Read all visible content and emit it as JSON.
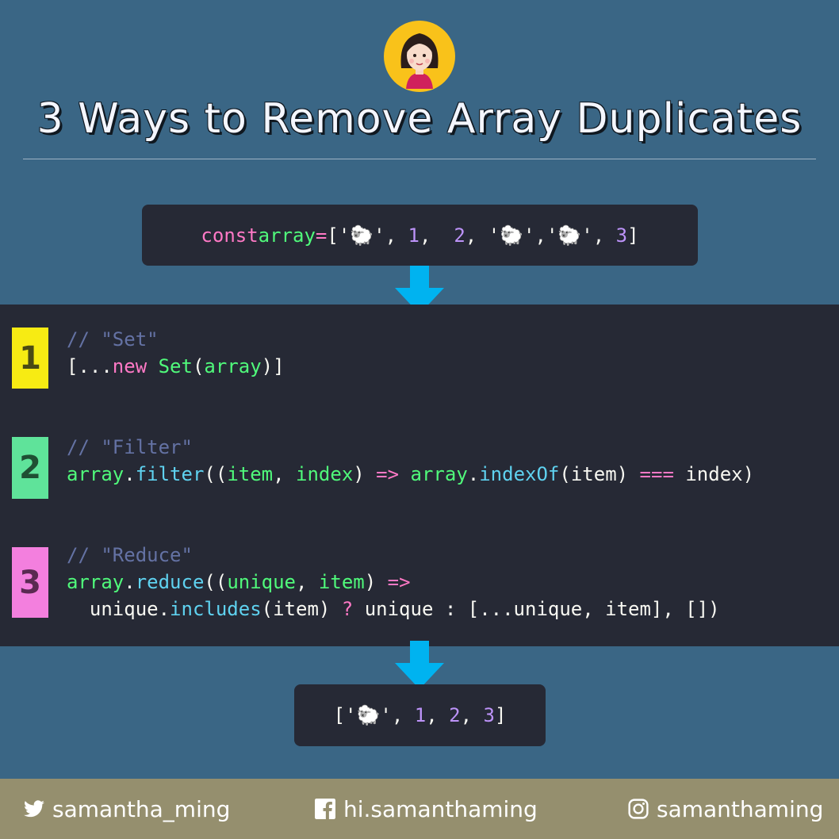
{
  "title": "3 Ways to Remove Array Duplicates",
  "input_code": {
    "kw": "const",
    "var": "array",
    "eq": "=",
    "open": "['",
    "sheep": "🐑",
    "q_comma": "', ",
    "n1": "1",
    "c1": ",  ",
    "n2": "2",
    "c2": ", '",
    "sheep2": "🐑",
    "mid": "','",
    "sheep3": "🐑",
    "q_comma2": "', ",
    "n3": "3",
    "close": "]"
  },
  "methods": [
    {
      "number": "1",
      "comment": "// \"Set\"",
      "line1": {
        "a": "[...",
        "b": "new",
        "c": " ",
        "d": "Set",
        "e": "(",
        "f": "array",
        "g": ")]"
      }
    },
    {
      "number": "2",
      "comment": "// \"Filter\"",
      "line1": {
        "a": "array",
        "b": ".",
        "c": "filter",
        "d": "((",
        "e": "item",
        "f": ", ",
        "g": "index",
        "h": ") ",
        "i": "=>",
        "j": " ",
        "k": "array",
        "l": ".",
        "m": "indexOf",
        "n": "(item) ",
        "o": "===",
        "p": " index)"
      }
    },
    {
      "number": "3",
      "comment": "// \"Reduce\"",
      "line1": {
        "a": "array",
        "b": ".",
        "c": "reduce",
        "d": "((",
        "e": "unique",
        "f": ", ",
        "g": "item",
        "h": ") ",
        "i": "=>"
      },
      "line2": {
        "a": "  unique.",
        "b": "includes",
        "c": "(item) ",
        "d": "?",
        "e": " unique : [...unique, item], [])"
      }
    }
  ],
  "output_code": {
    "open": "['",
    "sheep": "🐑",
    "q_comma": "', ",
    "n1": "1",
    "c1": ", ",
    "n2": "2",
    "c2": ", ",
    "n3": "3",
    "close": "]"
  },
  "footer": {
    "twitter": "samantha_ming",
    "facebook": "hi.samanthaming",
    "instagram": "samanthaming"
  },
  "colors": {
    "background": "#3a6685",
    "code_bg": "#262935",
    "arrow": "#00b3f0",
    "badge_1": "#f7eb13",
    "badge_2": "#5fe39a",
    "badge_3": "#f37fde",
    "footer": "#958f6e"
  },
  "icons": [
    "avatar-illustration",
    "arrow-down-icon",
    "twitter-icon",
    "facebook-icon",
    "instagram-icon"
  ]
}
